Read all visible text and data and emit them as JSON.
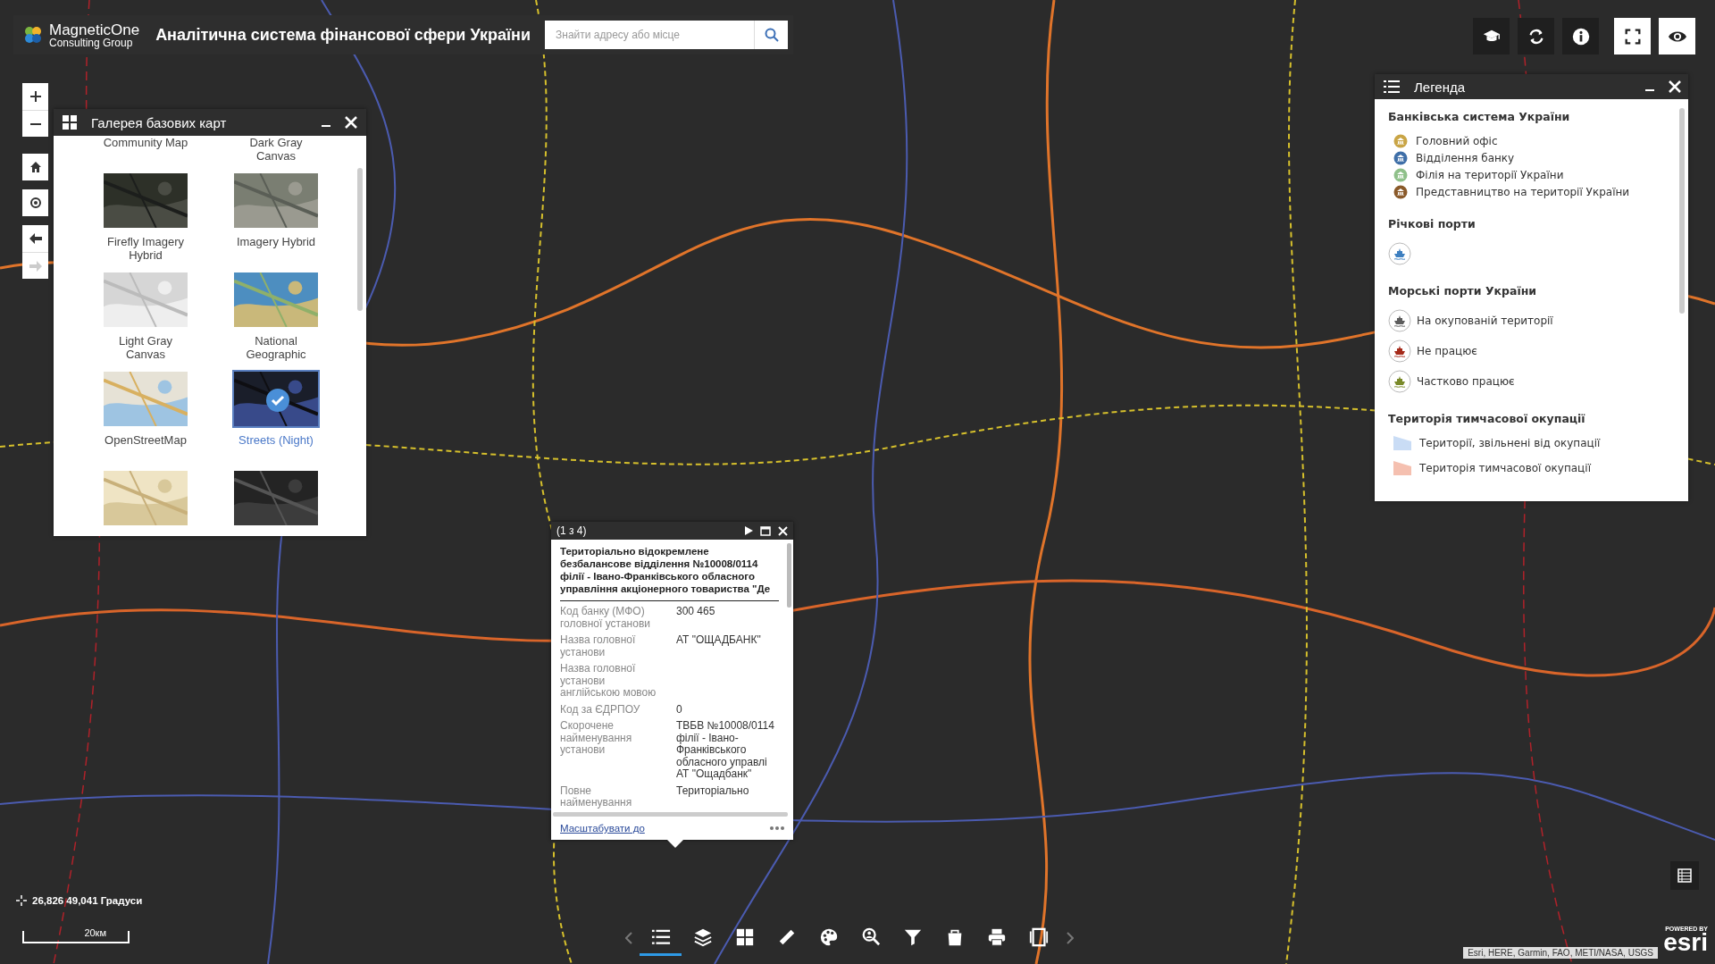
{
  "header": {
    "logo_line1": "MagneticOne",
    "logo_line2": "Consulting Group",
    "title": "Аналітична система фінансової сфери України",
    "search": {
      "placeholder": "Знайти адресу або місце"
    }
  },
  "top_buttons": [
    {
      "selected": false
    },
    {
      "selected": false
    },
    {
      "selected": false
    },
    {
      "selected": true
    },
    {
      "selected": true
    }
  ],
  "gallery": {
    "title": "Галерея базових карт",
    "items": [
      {
        "label": "Community Map",
        "selected": false
      },
      {
        "label": "Dark Gray Canvas",
        "selected": false
      },
      {
        "label": "Firefly Imagery Hybrid",
        "selected": false
      },
      {
        "label": "Imagery Hybrid",
        "selected": false
      },
      {
        "label": "Light Gray Canvas",
        "selected": false
      },
      {
        "label": "National Geographic",
        "selected": false
      },
      {
        "label": "OpenStreetMap",
        "selected": false
      },
      {
        "label": "Streets (Night)",
        "selected": true
      },
      {
        "selected": false
      },
      {
        "selected": false
      }
    ]
  },
  "legend": {
    "title": "Легенда",
    "sections": [
      {
        "title": "Банківська система України",
        "items": [
          {
            "kind": "bank",
            "color": "#c9a546",
            "label": "Головний офіс"
          },
          {
            "kind": "bank",
            "color": "#3f6fa8",
            "label": "Відділення банку"
          },
          {
            "kind": "bank",
            "color": "#8fc08a",
            "label": "Філія на території України"
          },
          {
            "kind": "bank",
            "color": "#8a5a2a",
            "label": "Представництво на території України"
          }
        ]
      },
      {
        "title": "Річкові порти",
        "items": [
          {
            "kind": "ship",
            "color": "#3d7fc0"
          }
        ]
      },
      {
        "title": "Морські порти України",
        "items": [
          {
            "kind": "ship",
            "color": "#5c5c5c",
            "label": "На окупованій території"
          },
          {
            "kind": "ship",
            "color": "#a52a1a",
            "label": "Не працює"
          },
          {
            "kind": "ship",
            "color": "#7a8a2a",
            "label": "Частково працює"
          }
        ]
      },
      {
        "title": "Територія тимчасової окупації",
        "items": [
          {
            "kind": "area",
            "color": "#c9dcf5",
            "label": "Території, звільнені від окупації"
          },
          {
            "kind": "area",
            "color": "#f5c0b0",
            "label": "Територія тимчасової окупації"
          }
        ]
      }
    ]
  },
  "popup": {
    "counter": "(1 з 4)",
    "title": "Територіально відокремлене безбалансове відділення №10008/0114 філії - Івано-Франківського обласного управління акціонерного товариства \"Де",
    "fields": [
      {
        "label": "Код банку (МФО) головної установи",
        "value": "300 465"
      },
      {
        "label": "Назва головної установи",
        "value": "АТ \"ОЩАДБАНК\""
      },
      {
        "label": "Назва головної установи англійською мовою"
      },
      {
        "label": "Код за ЄДРПОУ",
        "value": "0"
      },
      {
        "label": "Скорочене найменування установи",
        "value": "ТВБВ №10008/0114 філії - Івано-Франківського обласного управлі АТ \"Ощадбанк\""
      },
      {
        "label": "Повне найменування",
        "value": "Територіально"
      }
    ],
    "zoom_link": "Масштабувати до"
  },
  "coordinates": "26,826 49,041 Градуси",
  "scale": "20км",
  "toolbar": [
    {
      "selected": true
    },
    {
      "selected": false
    },
    {
      "selected": false
    },
    {
      "selected": false
    },
    {
      "selected": false
    },
    {
      "selected": false
    },
    {
      "selected": false
    },
    {
      "selected": false
    },
    {
      "selected": false
    },
    {
      "selected": false
    }
  ],
  "attribution": "Esri, HERE, Garmin, FAO, METI/NASA, USGS",
  "esri": {
    "powered": "POWERED BY",
    "logo": "esri"
  }
}
